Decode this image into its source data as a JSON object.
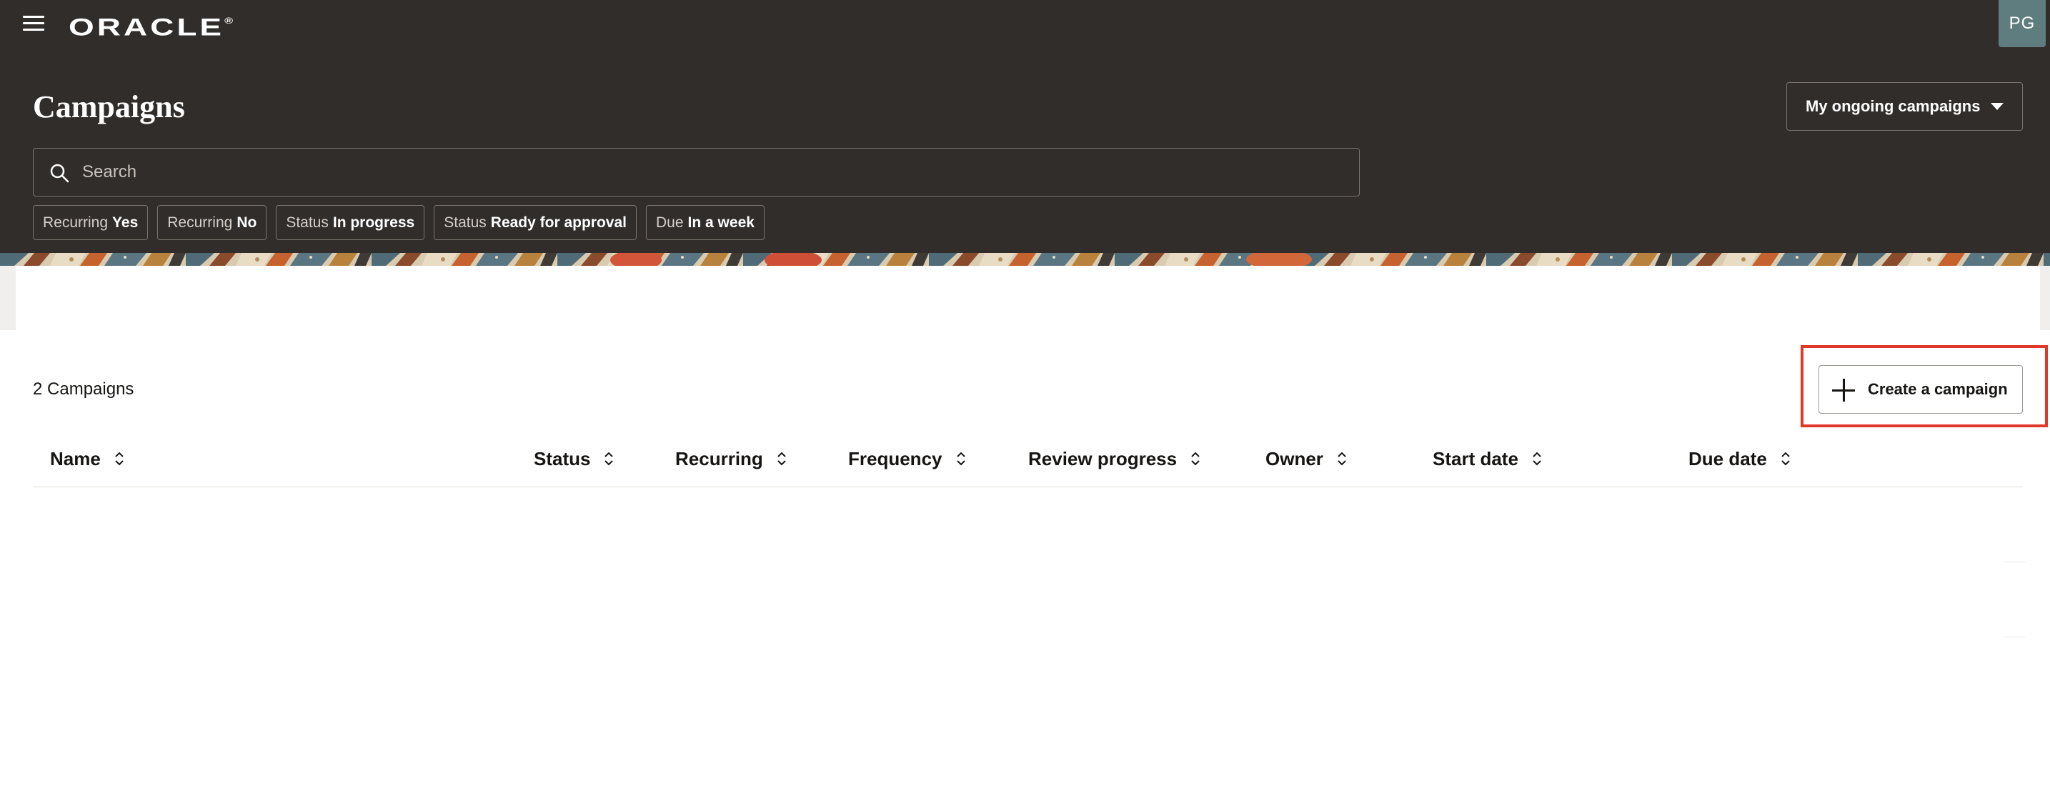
{
  "app": {
    "logo": "ORACLE",
    "logo_mark": "®",
    "avatar_initials": "PG"
  },
  "page": {
    "title": "Campaigns",
    "view_selector": "My ongoing campaigns"
  },
  "search": {
    "placeholder": "Search"
  },
  "filters": [
    {
      "key": "Recurring",
      "value": "Yes"
    },
    {
      "key": "Recurring",
      "value": "No"
    },
    {
      "key": "Status",
      "value": "In progress"
    },
    {
      "key": "Status",
      "value": "Ready for approval"
    },
    {
      "key": "Due",
      "value": "In a week"
    }
  ],
  "results": {
    "count_label": "2 Campaigns",
    "create_label": "Create a campaign"
  },
  "table": {
    "columns": [
      "Name",
      "Status",
      "Recurring",
      "Frequency",
      "Review progress",
      "Owner",
      "Start date",
      "Due date"
    ],
    "rows": []
  },
  "colors": {
    "header_bg": "#312d2a",
    "highlight": "#e0392b",
    "avatar_bg": "#5f7d7e"
  },
  "icons": {
    "menu": "hamburger-icon",
    "search": "search-icon",
    "dropdown": "caret-down-icon",
    "create": "plus-icon",
    "sort": "sort-icon"
  }
}
